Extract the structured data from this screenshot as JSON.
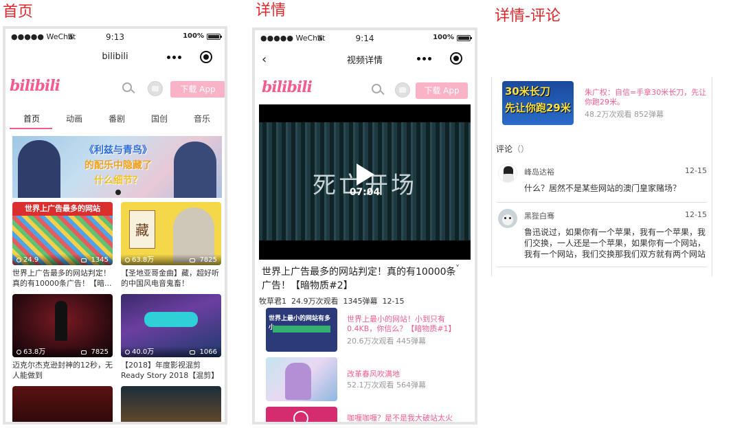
{
  "sections": {
    "home": "首页",
    "detail": "详情",
    "detail_comment": "详情-评论"
  },
  "status": {
    "signal": "●●●●● WeChat",
    "home_time": "9:13",
    "detail_time": "9:14",
    "battery": "100%"
  },
  "home": {
    "nav_title": "bilibili",
    "logo": "bilibili",
    "download": "下载 App",
    "tabs": [
      "首页",
      "动画",
      "番剧",
      "国创",
      "音乐"
    ],
    "banner_text": [
      "《利兹与青鸟》",
      "的配乐中隐藏了",
      "什么细节？"
    ],
    "cards": [
      {
        "thumb_text": "世界上广告最多的网站",
        "views": "24.9",
        "danmaku": "1345",
        "caption": "世界上广告最多的网站判定！真的有10000条广告！【暗..."
      },
      {
        "thumb_text": "藏",
        "views": "63.8万",
        "danmaku": "7825",
        "caption": "【圣地亚哥金曲】藏，超好听的中国风电音鬼畜！"
      },
      {
        "thumb_text": "",
        "views": "63.8万",
        "danmaku": "7825",
        "caption": "迈克尔杰克逊封神的12秒，无人能做到"
      },
      {
        "thumb_text": "",
        "views": "40.0万",
        "danmaku": "1066",
        "caption": "【2018】年度影视混剪 Ready Story 2018【混剪】"
      }
    ]
  },
  "detail": {
    "nav_title": "视频详情",
    "logo": "bilibili",
    "download": "下载 App",
    "player_text": "死亡开场",
    "duration": "07:04",
    "title_line1": "世界上广告最多的网站判定！真的有10000条",
    "title_line2": "广告！【暗物质#2】",
    "author": "牧草君1",
    "views": "24.9万次观看",
    "danmaku": "1345弹幕",
    "date": "12-15",
    "related": [
      {
        "thumb_text": "世界上最小的网站有多小",
        "title": "世界上最小的网站！小到只有0.4KB，你信么？【暗物质#1】",
        "stats": "20.6万次观看 445弹幕"
      },
      {
        "thumb_text": "",
        "title": "改革春风吹满地",
        "stats": "52.1万次观看 564弹幕"
      },
      {
        "thumb_text": "",
        "title": "咖喱咖喱？是不是我大破站太火",
        "stats": ""
      }
    ]
  },
  "comment_view": {
    "video": {
      "thumb_text_1": "30米长刀",
      "thumb_text_2": "先让你跑29米",
      "title": "朱广权：自信=手拿30米长刀，先让你跑29米。",
      "stats": "48.2万次观看 852弹幕"
    },
    "comment_label": "评论",
    "comment_count": "（）",
    "comments": [
      {
        "name": "峰岛达裕",
        "date": "12-15",
        "text": "什么？居然不是某些网站的澳门皇家赌场？"
      },
      {
        "name": "黑狴白骞",
        "date": "12-15",
        "text_lines": [
          "鲁迅说过，如果你有一个苹果，我有一个苹果，我",
          "们交换，一人还是一个苹果，如果你有一个网站，",
          "我有一个网站，我们交换那我们双方就有两个网站"
        ]
      }
    ]
  },
  "colors": {
    "accent": "#f25d8e",
    "section_title": "#e0262a",
    "download_button": "#f9b2c6"
  }
}
